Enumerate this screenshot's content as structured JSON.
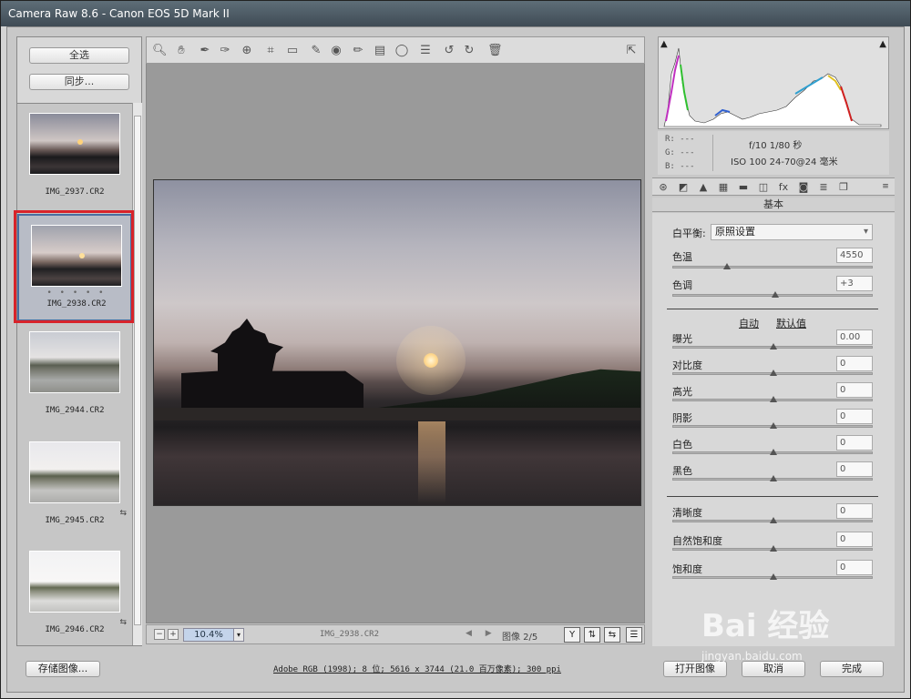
{
  "window": {
    "title": "Camera Raw 8.6 -  Canon EOS 5D Mark II"
  },
  "filmstrip": {
    "select_all_label": "全选",
    "sync_label": "同步...",
    "items": [
      {
        "name": "IMG_2937.CR2"
      },
      {
        "name": "IMG_2938.CR2",
        "rating": "• • • • •",
        "selected": true
      },
      {
        "name": "IMG_2944.CR2"
      },
      {
        "name": "IMG_2945.CR2",
        "badge": "⇆"
      },
      {
        "name": "IMG_2946.CR2",
        "badge": "⇆"
      }
    ]
  },
  "toolbar": {
    "tools": [
      "zoom-icon",
      "hand-icon",
      "white-balance-icon",
      "color-sampler-icon",
      "targeted-adjust-icon",
      "crop-icon",
      "straighten-icon",
      "spot-removal-icon",
      "red-eye-icon",
      "adjustment-brush-icon",
      "graduated-filter-icon",
      "radial-filter-icon",
      "preferences-icon",
      "rotate-left-icon",
      "rotate-right-icon",
      "trash-icon"
    ],
    "fullscreen_icon": "fullscreen-icon"
  },
  "status": {
    "zoom_minus": "−",
    "zoom_plus": "+",
    "zoom": "10.4%",
    "filename": "IMG_2938.CR2",
    "prev_next": "◀ ▶",
    "image_count": "图像 2/5",
    "icons": [
      "Y",
      "⇅",
      "⇆",
      "☰"
    ]
  },
  "histogram": {
    "shadow_clip_icon": "shadow-clipping-icon",
    "highlight_clip_icon": "highlight-clipping-icon"
  },
  "info": {
    "r": "R:  ---",
    "g": "G:  ---",
    "b": "B:  ---",
    "aperture_shutter": "f/10   1/80 秒",
    "iso_lens": "ISO 100   24-70@24 毫米"
  },
  "panel": {
    "title": "基本",
    "white_balance_label": "白平衡:",
    "white_balance_value": "原照设置",
    "temp": {
      "label": "色温",
      "value": "4550",
      "level": 0.27
    },
    "tint": {
      "label": "色调",
      "value": "+3",
      "level": 0.51
    },
    "auto_link": "自动",
    "default_link": "默认值",
    "tone": [
      {
        "label": "曝光",
        "value": "0.00",
        "level": 0.5
      },
      {
        "label": "对比度",
        "value": "0",
        "level": 0.5
      },
      {
        "label": "高光",
        "value": "0",
        "level": 0.5
      },
      {
        "label": "阴影",
        "value": "0",
        "level": 0.5
      },
      {
        "label": "白色",
        "value": "0",
        "level": 0.5
      },
      {
        "label": "黑色",
        "value": "0",
        "level": 0.5
      }
    ],
    "presence": [
      {
        "label": "清晰度",
        "value": "0",
        "level": 0.5
      },
      {
        "label": "自然饱和度",
        "value": "0",
        "level": 0.5
      },
      {
        "label": "饱和度",
        "value": "0",
        "level": 0.5
      }
    ]
  },
  "bottom": {
    "save_label": "存储图像...",
    "workflow": "Adobe RGB (1998); 8 位; 5616 x 3744 (21.0 百万像素); 300 ppi",
    "open_label": "打开图像",
    "cancel_label": "取消",
    "done_label": "完成"
  },
  "watermark": {
    "text": "Bai 经验",
    "sub": "jingyan.baidu.com"
  }
}
